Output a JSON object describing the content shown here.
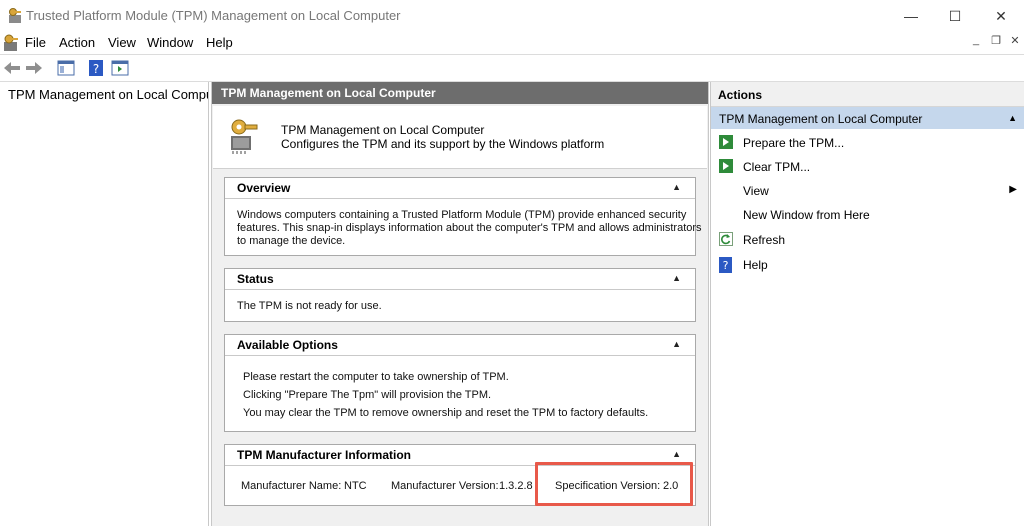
{
  "window": {
    "title": "Trusted Platform Module (TPM) Management on Local Computer",
    "minimize": "—",
    "maximize": "☐",
    "close": "✕"
  },
  "menu": {
    "items": [
      "File",
      "Action",
      "View",
      "Window",
      "Help"
    ],
    "mdi_minimize": "_",
    "mdi_restore": "❐",
    "mdi_close": "✕"
  },
  "tree": {
    "item": "TPM Management on Local Computer"
  },
  "center": {
    "header": "TPM Management on Local Computer",
    "intro_title": "TPM Management on Local Computer",
    "intro_desc": "Configures the TPM and its support by the Windows platform",
    "overview": {
      "heading": "Overview",
      "lines": [
        "Windows computers containing a Trusted Platform Module (TPM) provide enhanced security",
        "features. This snap-in displays information about the computer's TPM and allows administrators",
        "to manage the device."
      ]
    },
    "status": {
      "heading": "Status",
      "text": "The TPM is not ready for use."
    },
    "options": {
      "heading": "Available Options",
      "lines": [
        "Please restart the computer to take ownership of TPM.",
        "Clicking \"Prepare The Tpm\" will provision the TPM.",
        "You may clear the TPM to remove ownership and reset the TPM to factory defaults."
      ]
    },
    "manufacturer": {
      "heading": "TPM Manufacturer Information",
      "name_label": "Manufacturer Name:",
      "name_value": "NTC",
      "version_label": "Manufacturer Version:",
      "version_value": "1.3.2.8",
      "spec_label": "Specification Version:",
      "spec_value": "2.0"
    },
    "caret": "▲"
  },
  "actions": {
    "header": "Actions",
    "group": "TPM Management on Local Computer",
    "group_caret": "▲",
    "items": [
      {
        "label": "Prepare the TPM...",
        "icon": "green-arrow-icon"
      },
      {
        "label": "Clear TPM...",
        "icon": "green-arrow-icon"
      },
      {
        "label": "View",
        "icon": "none",
        "submenu": "▶"
      },
      {
        "label": "New Window from Here",
        "icon": "none"
      },
      {
        "label": "Refresh",
        "icon": "refresh-icon"
      },
      {
        "label": "Help",
        "icon": "help-icon"
      }
    ]
  },
  "colors": {
    "center_header_bg": "#6d6d6d",
    "actions_group_bg": "#c5d7ec",
    "highlight_border": "#e8594a",
    "action_green": "#2e8b3a",
    "help_blue": "#2b59c3"
  }
}
